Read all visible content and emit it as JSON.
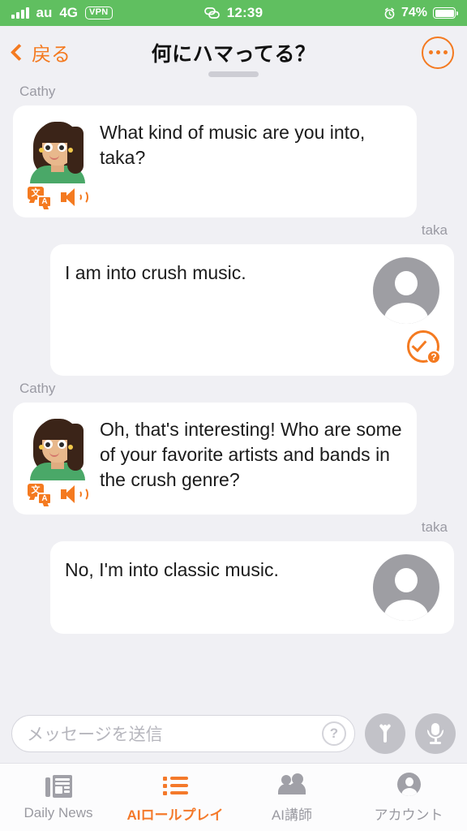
{
  "status_bar": {
    "carrier": "au",
    "network": "4G",
    "vpn_badge": "VPN",
    "time": "12:39",
    "battery_percent": "74%",
    "signal_icon": "signal-bars-icon",
    "link_icon": "chain-link-icon",
    "alarm_icon": "alarm-clock-icon",
    "battery_icon": "battery-icon",
    "background_color": "#60bf60"
  },
  "header": {
    "back_label": "戻る",
    "title": "何にハマってる？",
    "more_icon": "ellipsis-icon",
    "accent_color": "#f47a20"
  },
  "chat": {
    "messages": [
      {
        "sender": "Cathy",
        "side": "left",
        "text": "What kind of music are you into, taka?",
        "actions": [
          "translate-icon",
          "speaker-icon"
        ]
      },
      {
        "sender": "taka",
        "side": "right",
        "text": "I am into crush music.",
        "badge": "check-question-icon"
      },
      {
        "sender": "Cathy",
        "side": "left",
        "text": "Oh, that's interesting! Who are some of your favorite artists and bands in the crush genre?",
        "actions": [
          "translate-icon",
          "speaker-icon"
        ]
      },
      {
        "sender": "taka",
        "side": "right",
        "text": "No, I'm into classic music."
      }
    ],
    "translate_glyph_primary": "文",
    "translate_glyph_secondary": "A"
  },
  "input_bar": {
    "placeholder": "メッセージを送信",
    "value": "",
    "help_icon": "question-mark-icon",
    "send_icon": "arrow-up-icon",
    "mic_icon": "microphone-icon"
  },
  "tab_bar": {
    "tabs": [
      {
        "label": "Daily News",
        "icon": "newspaper-icon",
        "active": false
      },
      {
        "label": "AIロールプレイ",
        "icon": "list-icon",
        "active": true
      },
      {
        "label": "AI講師",
        "icon": "people-icon",
        "active": false
      },
      {
        "label": "アカウント",
        "icon": "account-circle-icon",
        "active": false
      }
    ],
    "active_color": "#f4792a",
    "inactive_color": "#9a9aa1"
  }
}
